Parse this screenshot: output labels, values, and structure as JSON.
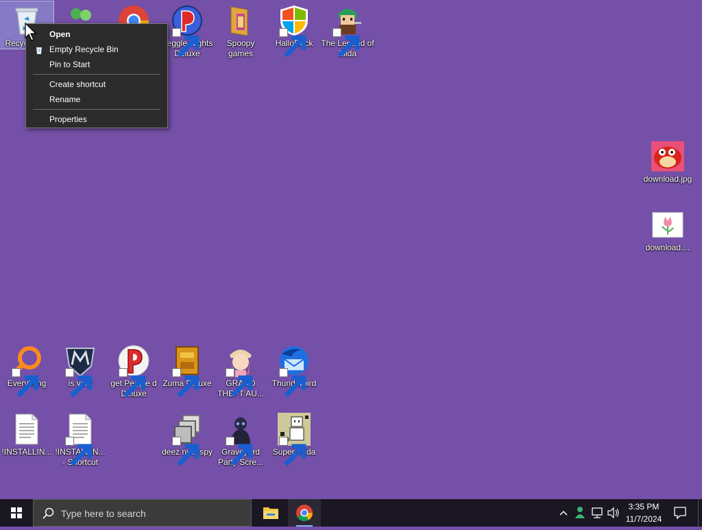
{
  "desktop": {
    "icons": {
      "recycle_bin": "Recycle Bin",
      "peggle_nights": "Peggle Nights Deluxe",
      "spoopy_games": "Spoopy games",
      "hallodock": "HalloDock",
      "zilda": "The Legend of Zilda",
      "download_jpg": "download.jpg",
      "download_2": "download....",
      "everything": "Everything",
      "is_very": "is very",
      "get_peggle": "get Peggle d Deluxe",
      "zuma": "Zuma Deluxe",
      "grand_theft": "GRAND THEFT AU...",
      "thunderbird": "Thunderbird",
      "installing_1": "!INSTALLIN...",
      "installing_2": "!INSTALLIN... - Shortcut",
      "deez_nuts": "deez nuts spy",
      "graveyard": "Graveyard Party Scre...",
      "super_hilda": "Super Hilda"
    }
  },
  "context_menu": {
    "open": "Open",
    "empty_recycle_bin": "Empty Recycle Bin",
    "pin_to_start": "Pin to Start",
    "create_shortcut": "Create shortcut",
    "rename": "Rename",
    "properties": "Properties"
  },
  "taskbar": {
    "search_placeholder": "Type here to search",
    "time": "3:35 PM",
    "date": "11/7/2024"
  },
  "colors": {
    "desktop_bg": "#7450a8",
    "menu_bg": "#2b2b2b",
    "taskbar_bg": "#1a1622"
  }
}
